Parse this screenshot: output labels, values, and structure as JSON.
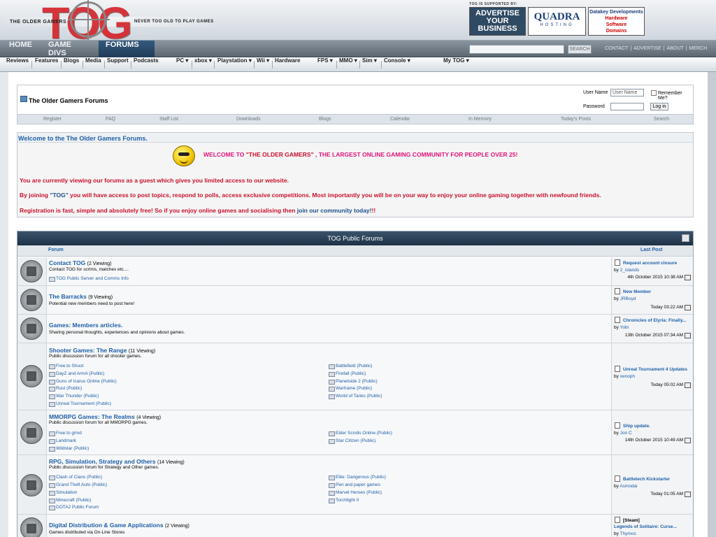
{
  "header": {
    "logo_tagline_left": "THE OLDER GAMERS",
    "logo_tagline_right": "NEVER TOO OLD TO PLAY GAMES",
    "supported_text": "TOG IS SUPPORTED BY:",
    "ad1": [
      "ADVERTISE",
      "YOUR",
      "BUSINESS"
    ],
    "ad2_title": "QUADRA",
    "ad2_sub": "HOSTING",
    "ad3": [
      "Datakey Developments",
      "Hardware",
      "Software",
      "Domains"
    ]
  },
  "nav": {
    "tabs": [
      "HOME",
      "GAME DIVS",
      "FORUMS"
    ],
    "search_button": "SEARCH",
    "top_links": [
      "CONTACT",
      "ADVERTISE",
      "ABOUT",
      "MERCH"
    ]
  },
  "subnav": {
    "items": [
      "Reviews",
      "Features",
      "Blogs",
      "Media",
      "Support",
      "Podcasts",
      "PC ▾",
      "xbox ▾",
      "Playstation ▾",
      "Wii ▾",
      "Hardware",
      "FPS ▾",
      "MMO ▾",
      "Sim ▾",
      "Console ▾",
      "My TOG ▾"
    ]
  },
  "vb": {
    "breadcrumb_title": "The Older Gamers Forums",
    "username_label": "User Name",
    "username_placeholder": "User Name",
    "remember_label": "Remember Me?",
    "password_label": "Password",
    "login_button": "Log in",
    "navlinks": [
      "Register",
      "FAQ",
      "Staff List",
      "Downloads",
      "Blogs",
      "Calendar",
      "In Memory",
      "Today's Posts",
      "Search"
    ]
  },
  "welcome": {
    "heading": "Welcome to the The Older Gamers Forums.",
    "banner_a": "WELCOME TO ",
    "banner_b": "\"THE OLDER GAMERS\"",
    "banner_c": " , THE LARGEST ONLINE GAMING COMMUNITY FOR PEOPLE OVER 25!",
    "line1": "You are currently viewing our forums as a guest which gives you limited access to our website.",
    "line2_a": "By joining ",
    "line2_b": "\"TOG\"",
    "line2_c": " you will have access to post topics, respond to polls, access exclusive competitions. Most importantly you will be on your way to enjoy your online gaming together with newfound friends.",
    "line3_a": "Registration is fast, simple and absolutely free! So if you enjoy online games and socialising then ",
    "line3_b": "join our community today!",
    "line3_c": "!!"
  },
  "forums": {
    "header": "TOG Public Forums",
    "col_forum": "Forum",
    "col_last": "Last Post",
    "rows": [
      {
        "title": "Contact TOG",
        "viewing": "(2 Viewing)",
        "desc": "Contact TOG for scrims, matches etc....",
        "subs": [
          "TOG Public Server and Comms Info"
        ],
        "lp_title": "Request account closure",
        "lp_by": "by",
        "lp_user": "2_islands",
        "lp_date": "4th October 2015 10:38 AM"
      },
      {
        "title": "The Barracks",
        "viewing": "(9 Viewing)",
        "desc": "Potential new members need to post here!",
        "subs": [],
        "lp_title": "New Member",
        "lp_by": "by",
        "lp_user": "JRBoyd",
        "lp_date": "Today 03:22 AM"
      },
      {
        "title": "Games: Members articles.",
        "viewing": "",
        "desc": "Sharing personal thoughts, experiences and opinions about games.",
        "subs": [],
        "lp_title": "Chronicles of Elyria: Finally...",
        "lp_by": "by",
        "lp_user": "Yobi",
        "lp_date": "13th October 2015 07:34 AM"
      },
      {
        "title": "Shooter Games: The Range",
        "viewing": "(11 Viewing)",
        "desc": "Public discussion forum for all shooter games.",
        "subs": [
          "Free to Shoot",
          "DayZ and ArmA (Public)",
          "Guns of Icarus Online (Public)",
          "Rust (Public)",
          "War Thunder (Public)",
          "Unreal Tournament (Public)",
          "Battlefield (Public)",
          "Firefall (Public)",
          "Planetside 2 (Public)",
          "Warframe (Public)",
          "World of Tanks (Public)"
        ],
        "lp_title": "Unreal Tournament 4 Updates",
        "lp_by": "by",
        "lp_user": "xenoph",
        "lp_date": "Today 05:02 AM"
      },
      {
        "title": "MMORPG Games: The Realms",
        "viewing": "(4 Viewing)",
        "desc": "Public discussion forum for all MMORPG games.",
        "subs": [
          "Free to grind",
          "Landmark",
          "Wildstar (Public)",
          "Elder Scrolls Online (Public)",
          "Star Citizen (Public)"
        ],
        "lp_title": "Ship update.",
        "lp_by": "by",
        "lp_user": "Jon C",
        "lp_date": "14th October 2015 10:49 AM"
      },
      {
        "title": "RPG, Simulation, Strategy and Others",
        "viewing": "(14 Viewing)",
        "desc": "Public discussion forum for Strategy and Other games.",
        "subs": [
          "Clash of Clans (Public)",
          "Grand Theft Auto (Public)",
          "Simulation",
          "Minecraft (Public)",
          "DOTA2 Public Forum",
          "Elite: Dangerous (Public)",
          "Pen and paper games",
          "Marvel Heroes (Public)",
          "Torchlight II"
        ],
        "lp_title": "Battletech Kickstarter",
        "lp_by": "by",
        "lp_user": "Asmodai",
        "lp_date": "Today 01:05 AM"
      },
      {
        "title": "Digital Distribution & Game Applications",
        "viewing": "(2 Viewing)",
        "desc": "Games distributed via On-Line Stores",
        "subs": [],
        "lp_title": "[Steam]",
        "lp_title2": "Legends of Solitaire: Curse...",
        "lp_by": "by",
        "lp_user": "Thymos",
        "lp_date": ""
      }
    ]
  }
}
